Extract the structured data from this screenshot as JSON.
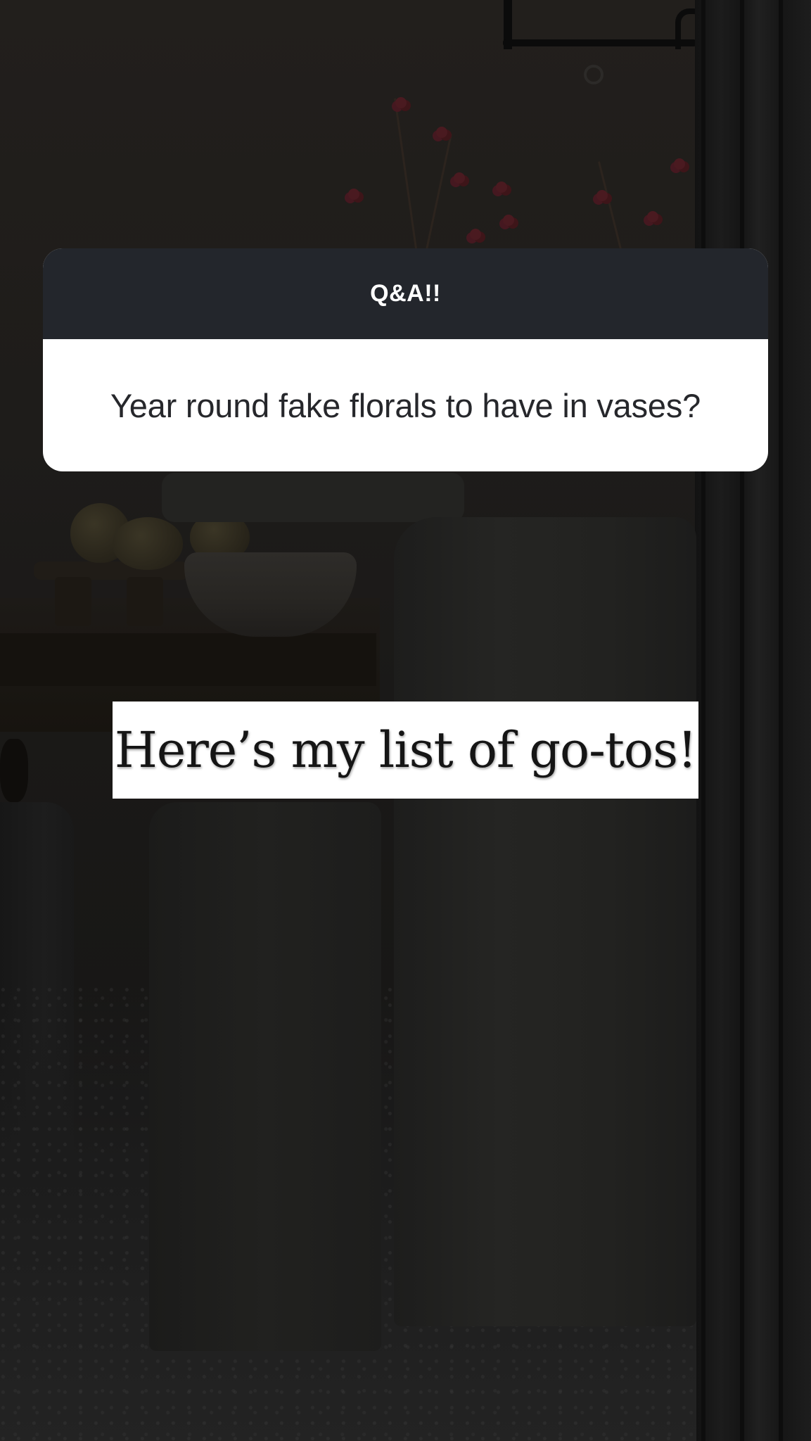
{
  "question_sticker": {
    "title": "Q&A!!",
    "question": "Year round fake florals to have in vases?"
  },
  "caption": {
    "text": "Here’s my list of go-tos!"
  },
  "colors": {
    "sticker_header": "#23262c",
    "sticker_body": "#ffffff",
    "question_text": "#26272b",
    "caption_background": "#ffffff",
    "caption_text": "#151515",
    "background_photo": "#161514"
  }
}
